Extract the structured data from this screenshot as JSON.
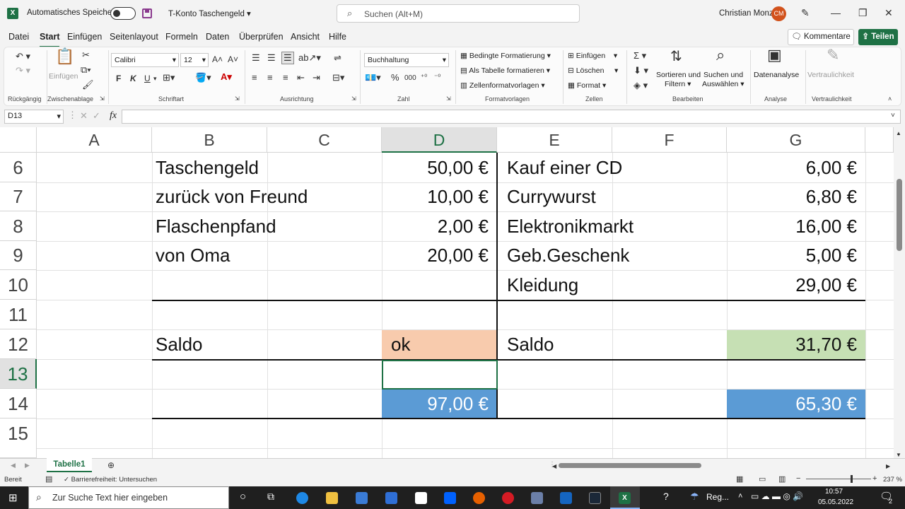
{
  "titlebar": {
    "autosave_label": "Automatisches Speichern",
    "doc_title": "T-Konto Taschengeld",
    "search_placeholder": "Suchen (Alt+M)",
    "user_name": "Christian Monz",
    "user_initials": "CM"
  },
  "menu": {
    "items": [
      "Datei",
      "Start",
      "Einfügen",
      "Seitenlayout",
      "Formeln",
      "Daten",
      "Überprüfen",
      "Ansicht",
      "Hilfe"
    ],
    "active": "Start",
    "kommentare": "Kommentare",
    "teilen": "Teilen"
  },
  "ribbon": {
    "groups": {
      "undo": "Rückgängig",
      "clipboard": "Zwischenablage",
      "font": "Schriftart",
      "alignment": "Ausrichtung",
      "number": "Zahl",
      "styles": "Formatvorlagen",
      "cells": "Zellen",
      "editing": "Bearbeiten",
      "analysis": "Analyse",
      "sensitivity": "Vertraulichkeit"
    },
    "paste_label": "Einfügen",
    "font_name": "Calibri",
    "font_size": "12",
    "number_format": "Buchhaltung",
    "bold": "F",
    "italic": "K",
    "underline": "U",
    "styles_items": [
      "Bedingte Formatierung",
      "Als Tabelle formatieren",
      "Zellenformatvorlagen"
    ],
    "cells_items": [
      "Einfügen",
      "Löschen",
      "Format"
    ],
    "sort_label_1": "Sortieren und",
    "sort_label_2": "Filtern",
    "find_label_1": "Suchen und",
    "find_label_2": "Auswählen",
    "analyse_label": "Datenanalyse",
    "sensitivity_label": "Vertraulichkeit"
  },
  "formula_bar": {
    "name_box": "D13",
    "fx": "fx",
    "formula": ""
  },
  "grid": {
    "columns": [
      "A",
      "B",
      "C",
      "D",
      "E",
      "F",
      "G"
    ],
    "selected_column": "D",
    "rows": [
      "6",
      "7",
      "8",
      "9",
      "10",
      "11",
      "12",
      "13",
      "14",
      "15"
    ],
    "selected_row": "13",
    "cells": {
      "B6": "Taschengeld",
      "D6": "50,00 €",
      "E6": "Kauf einer CD",
      "G6": "6,00 €",
      "B7": "zurück von Freund",
      "D7": "10,00 €",
      "E7": "Currywurst",
      "G7": "6,80 €",
      "B8": "Flaschenpfand",
      "D8": "2,00 €",
      "E8": "Elektronikmarkt",
      "G8": "16,00 €",
      "B9": "von Oma",
      "D9": "20,00 €",
      "E9": "Geb.Geschenk",
      "G9": "5,00 €",
      "E10": "Kleidung",
      "G10": "29,00 €",
      "B12": "Saldo",
      "D12": "ok",
      "E12": "Saldo",
      "G12": "31,70 €",
      "D14": "97,00 €",
      "G14": "65,30 €"
    },
    "colors": {
      "peach": "#f8cbad",
      "green": "#c6e0b4",
      "blue": "#5b9bd5",
      "accent": "#1e7145"
    }
  },
  "sheets": {
    "tabs": [
      "Tabelle1"
    ],
    "active": "Tabelle1"
  },
  "status": {
    "ready": "Bereit",
    "accessibility": "Barrierefreiheit: Untersuchen",
    "zoom": "237 %"
  },
  "taskbar": {
    "search_placeholder": "Zur Suche Text hier eingeben",
    "weather": "Reg...",
    "time": "10:57",
    "date": "05.05.2022",
    "notifications": "2"
  }
}
